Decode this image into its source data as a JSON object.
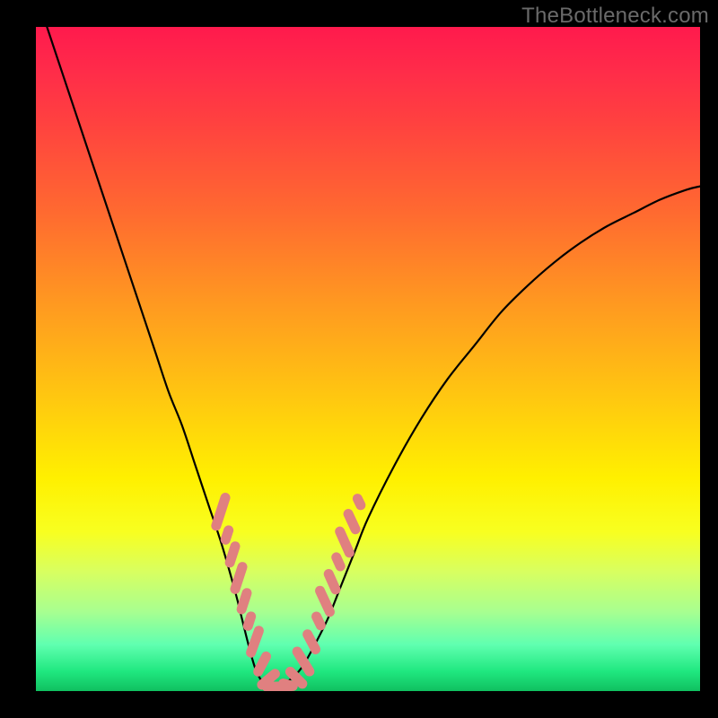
{
  "watermark": "TheBottleneck.com",
  "colors": {
    "background": "#000000",
    "gradient_top": "#ff1a4d",
    "gradient_mid": "#fff000",
    "gradient_bottom": "#10c060",
    "curve": "#000000",
    "marker": "#e08080"
  },
  "chart_data": {
    "type": "line",
    "title": "",
    "xlabel": "",
    "ylabel": "",
    "xlim": [
      0,
      100
    ],
    "ylim": [
      0,
      100
    ],
    "x": [
      0,
      2,
      4,
      6,
      8,
      10,
      12,
      14,
      16,
      18,
      20,
      22,
      24,
      26,
      28,
      30,
      31,
      32,
      33,
      34,
      35,
      36,
      38,
      40,
      42,
      44,
      46,
      48,
      50,
      54,
      58,
      62,
      66,
      70,
      74,
      78,
      82,
      86,
      90,
      94,
      98,
      100
    ],
    "y": [
      105,
      99,
      93,
      87,
      81,
      75,
      69,
      63,
      57,
      51,
      45,
      40,
      34,
      28,
      22,
      15,
      11,
      7,
      3.5,
      1.5,
      0.5,
      0.5,
      1.5,
      3.5,
      7,
      11,
      16,
      21,
      26,
      34,
      41,
      47,
      52,
      57,
      61,
      64.5,
      67.5,
      70,
      72,
      74,
      75.5,
      76
    ],
    "minimum_x": 35,
    "markers_left": [
      {
        "x": 27.8,
        "y": 27.0,
        "len": 6,
        "angle": -72
      },
      {
        "x": 28.8,
        "y": 23.5,
        "len": 3,
        "angle": -72
      },
      {
        "x": 29.6,
        "y": 20.5,
        "len": 4,
        "angle": -72
      },
      {
        "x": 30.5,
        "y": 17.0,
        "len": 5,
        "angle": -72
      },
      {
        "x": 31.4,
        "y": 13.5,
        "len": 4,
        "angle": -72
      },
      {
        "x": 32.2,
        "y": 10.5,
        "len": 3,
        "angle": -72
      },
      {
        "x": 33.0,
        "y": 7.5,
        "len": 5,
        "angle": -70
      },
      {
        "x": 34.0,
        "y": 4.0,
        "len": 4,
        "angle": -62
      },
      {
        "x": 35.0,
        "y": 1.8,
        "len": 4,
        "angle": -40
      }
    ],
    "markers_bottom": [
      {
        "x": 36.5,
        "y": 0.7,
        "len": 5,
        "angle": 0
      },
      {
        "x": 38.0,
        "y": 0.9,
        "len": 3,
        "angle": 15
      }
    ],
    "markers_right": [
      {
        "x": 39.2,
        "y": 2.0,
        "len": 4,
        "angle": 45
      },
      {
        "x": 40.3,
        "y": 4.5,
        "len": 5,
        "angle": 58
      },
      {
        "x": 41.5,
        "y": 7.5,
        "len": 4,
        "angle": 62
      },
      {
        "x": 42.5,
        "y": 10.5,
        "len": 3,
        "angle": 64
      },
      {
        "x": 43.5,
        "y": 13.5,
        "len": 5,
        "angle": 65
      },
      {
        "x": 44.6,
        "y": 16.5,
        "len": 4,
        "angle": 66
      },
      {
        "x": 45.5,
        "y": 19.5,
        "len": 3,
        "angle": 66
      },
      {
        "x": 46.5,
        "y": 22.5,
        "len": 5,
        "angle": 66
      },
      {
        "x": 47.6,
        "y": 25.5,
        "len": 4,
        "angle": 65
      },
      {
        "x": 48.7,
        "y": 28.5,
        "len": 2.5,
        "angle": 64
      }
    ]
  }
}
